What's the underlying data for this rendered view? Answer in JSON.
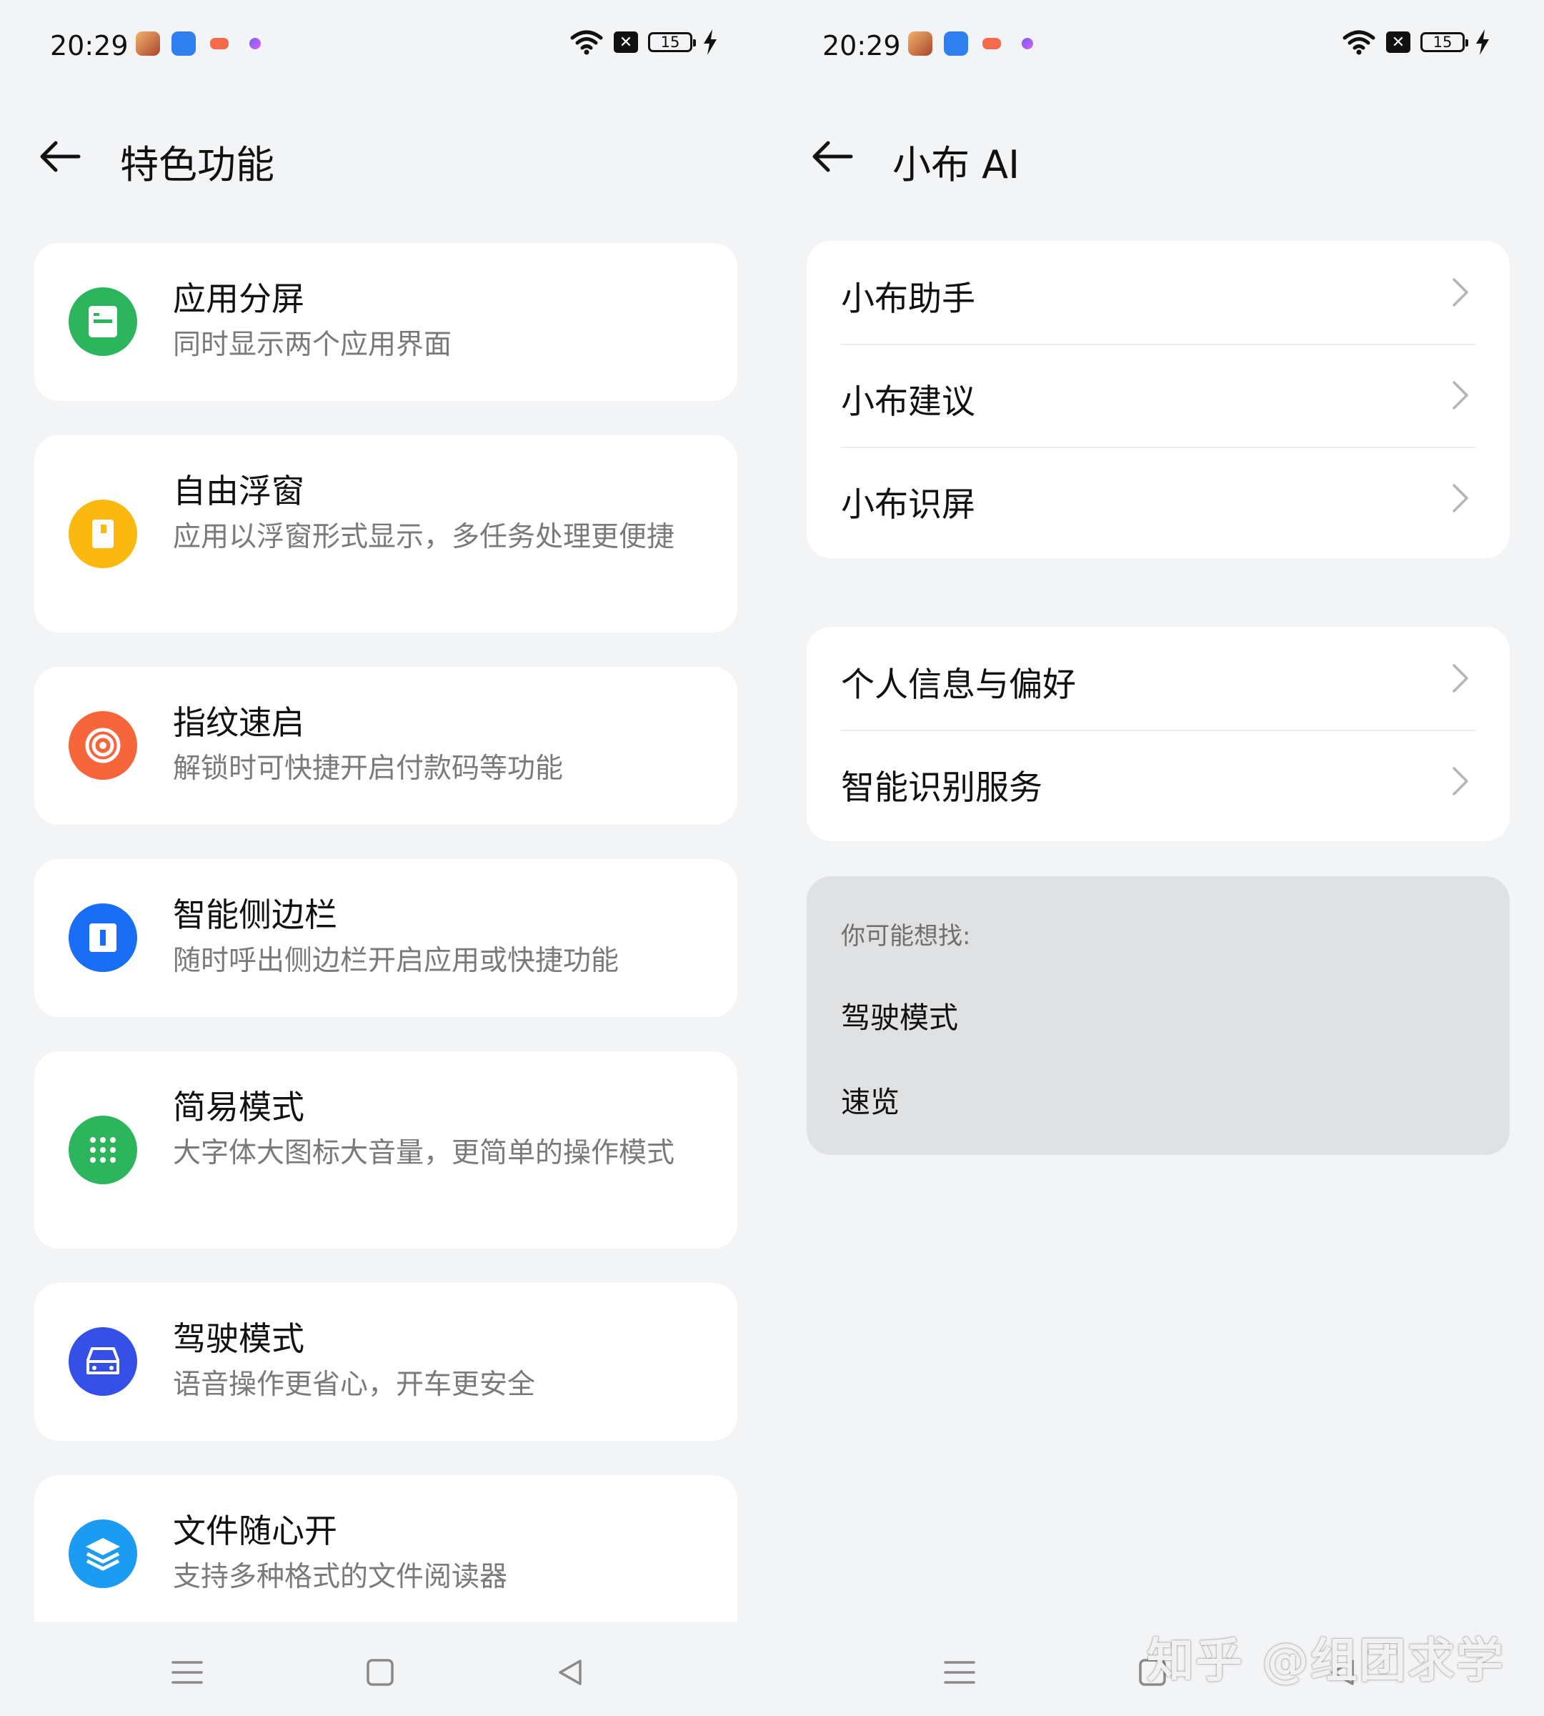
{
  "status_bar": {
    "time": "20:29",
    "battery": "15"
  },
  "left": {
    "title": "特色功能",
    "features": [
      {
        "title": "应用分屏",
        "desc": "同时显示两个应用界面",
        "icon": "split-screen-icon",
        "color": "#2db55d"
      },
      {
        "title": "自由浮窗",
        "desc": "应用以浮窗形式显示，多任务处理更便捷",
        "icon": "floating-window-icon",
        "color": "#fbb90f"
      },
      {
        "title": "指纹速启",
        "desc": "解锁时可快捷开启付款码等功能",
        "icon": "fingerprint-icon",
        "color": "#f7653b"
      },
      {
        "title": "智能侧边栏",
        "desc": "随时呼出侧边栏开启应用或快捷功能",
        "icon": "sidebar-icon",
        "color": "#1a6ef5"
      },
      {
        "title": "简易模式",
        "desc": "大字体大图标大音量，更简单的操作模式",
        "icon": "grid-dots-icon",
        "color": "#2db55d"
      },
      {
        "title": "驾驶模式",
        "desc": "语音操作更省心，开车更安全",
        "icon": "car-icon",
        "color": "#3550e6"
      },
      {
        "title": "文件随心开",
        "desc": "支持多种格式的文件阅读器",
        "icon": "layers-icon",
        "color": "#1c9bf2"
      }
    ]
  },
  "right": {
    "title": "小布 AI",
    "group1": [
      "小布助手",
      "小布建议",
      "小布识屏"
    ],
    "group2": [
      "个人信息与偏好",
      "智能识别服务"
    ],
    "suggest": {
      "title": "你可能想找:",
      "items": [
        "驾驶模式",
        "速览"
      ]
    }
  },
  "watermark": "知乎 @组团求学"
}
